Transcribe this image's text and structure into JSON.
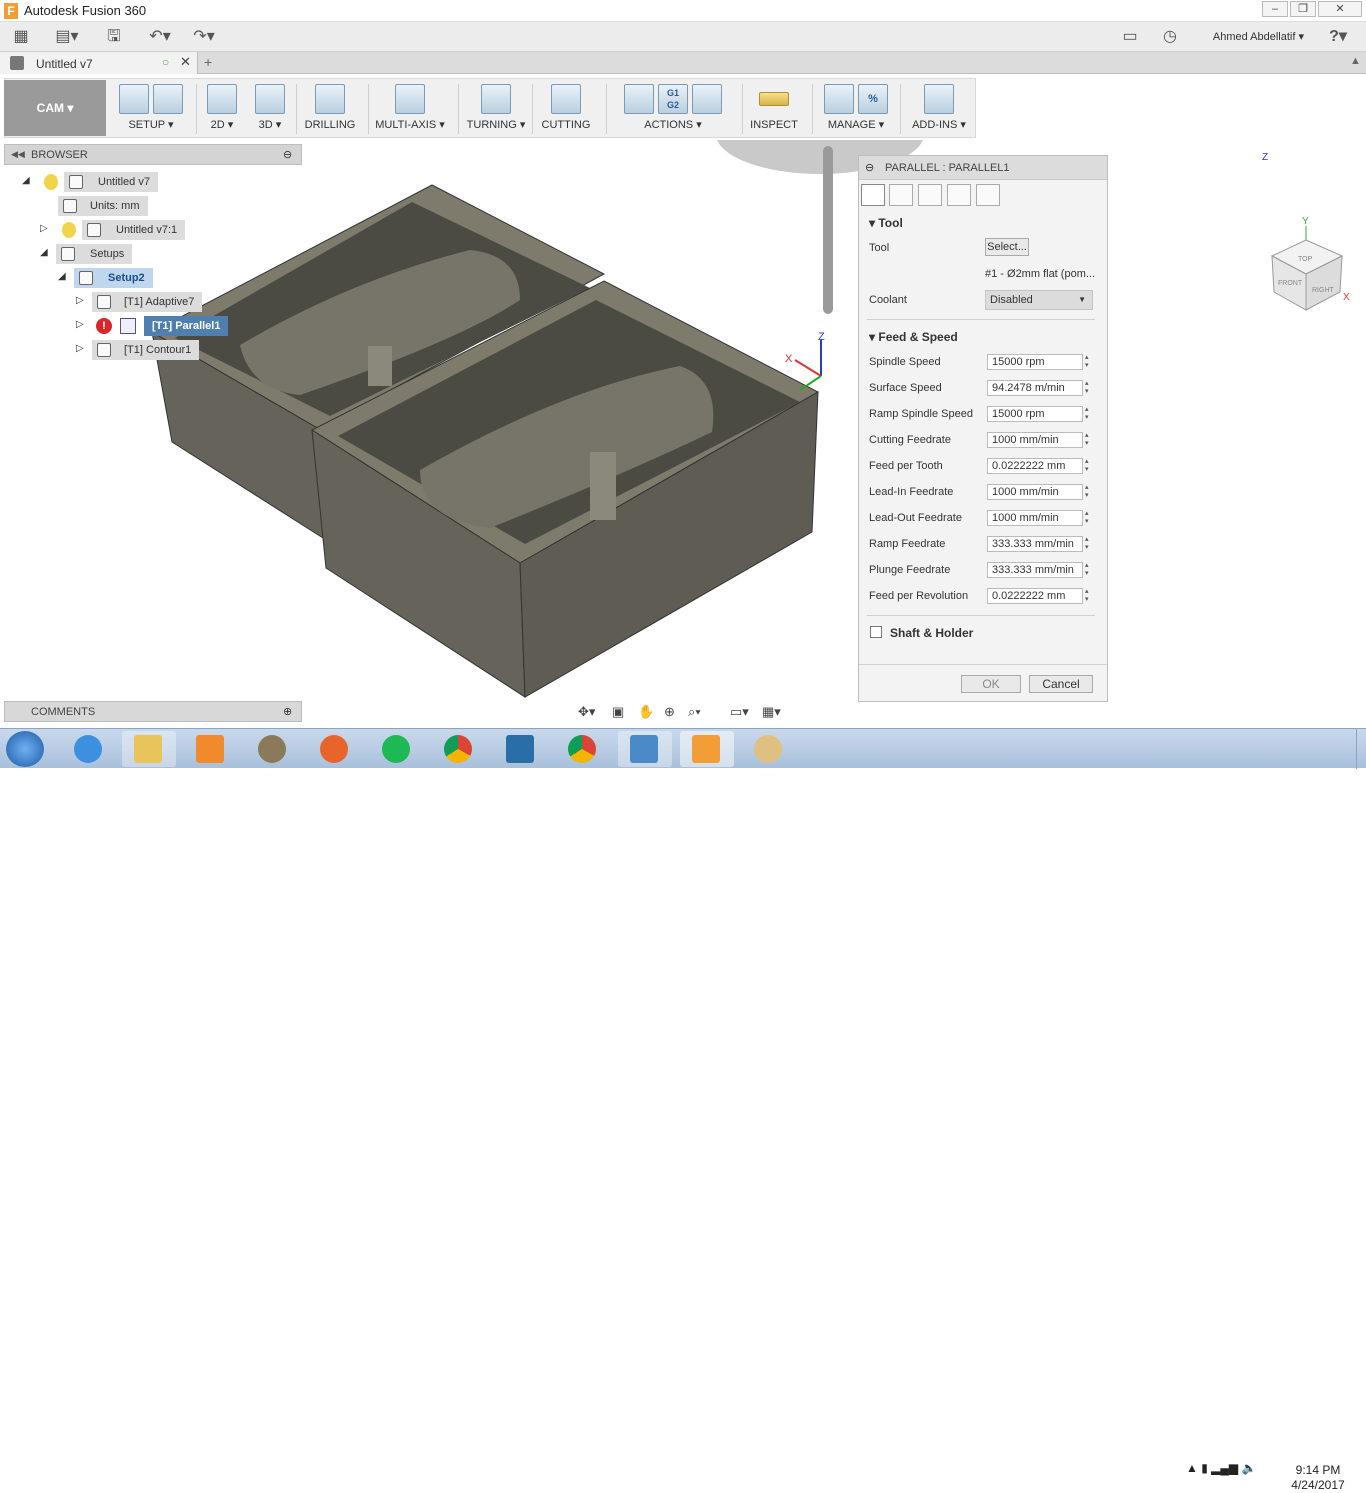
{
  "window": {
    "app_title": "Autodesk Fusion 360",
    "logo_letter": "F"
  },
  "appbar": {
    "user_name": "Ahmed Abdellatif",
    "help": "?"
  },
  "document_tab": {
    "title": "Untitled v7"
  },
  "toolbar": {
    "workspace": "CAM",
    "groups": [
      "SETUP",
      "2D",
      "3D",
      "DRILLING",
      "MULTI-AXIS",
      "TURNING",
      "CUTTING",
      "ACTIONS",
      "INSPECT",
      "MANAGE",
      "ADD-INS"
    ],
    "actions_icon_text": "G1\nG2"
  },
  "browser": {
    "title": "BROWSER",
    "tree": [
      "Untitled v7",
      "Units: mm",
      "Untitled v7:1",
      "Setups",
      "Setup2",
      "[T1] Adaptive7",
      "[T1] Parallel1",
      "[T1] Contour1"
    ]
  },
  "comments": {
    "title": "COMMENTS"
  },
  "panel": {
    "title": "PARALLEL : PARALLEL1",
    "tool_section": "Tool",
    "tool_label": "Tool",
    "tool_select": "Select...",
    "tool_desc": "#1 - Ø2mm flat (pom...",
    "coolant_label": "Coolant",
    "coolant_value": "Disabled",
    "feed_section": "Feed & Speed",
    "rows": [
      {
        "label": "Spindle Speed",
        "value": "15000 rpm"
      },
      {
        "label": "Surface Speed",
        "value": "94.2478 m/min"
      },
      {
        "label": "Ramp Spindle Speed",
        "value": "15000 rpm"
      },
      {
        "label": "Cutting Feedrate",
        "value": "1000 mm/min"
      },
      {
        "label": "Feed per Tooth",
        "value": "0.0222222 mm"
      },
      {
        "label": "Lead-In Feedrate",
        "value": "1000 mm/min"
      },
      {
        "label": "Lead-Out Feedrate",
        "value": "1000 mm/min"
      },
      {
        "label": "Ramp Feedrate",
        "value": "333.333 mm/min"
      },
      {
        "label": "Plunge Feedrate",
        "value": "333.333 mm/min"
      },
      {
        "label": "Feed per Revolution",
        "value": "0.0222222 mm"
      }
    ],
    "shaft_label": "Shaft & Holder",
    "ok": "OK",
    "cancel": "Cancel"
  },
  "viewcube": {
    "top": "TOP",
    "front": "FRONT",
    "right": "RIGHT",
    "x": "X",
    "y": "Y",
    "z": "Z"
  },
  "triad": {
    "x": "X",
    "z": "Z"
  },
  "clock": {
    "time": "9:14 PM",
    "date": "4/24/2017"
  },
  "colors": {
    "accent": "#4a7aa8",
    "selected": "#4f7fae",
    "warning": "#d9262c",
    "fusion_orange": "#f29d35"
  }
}
